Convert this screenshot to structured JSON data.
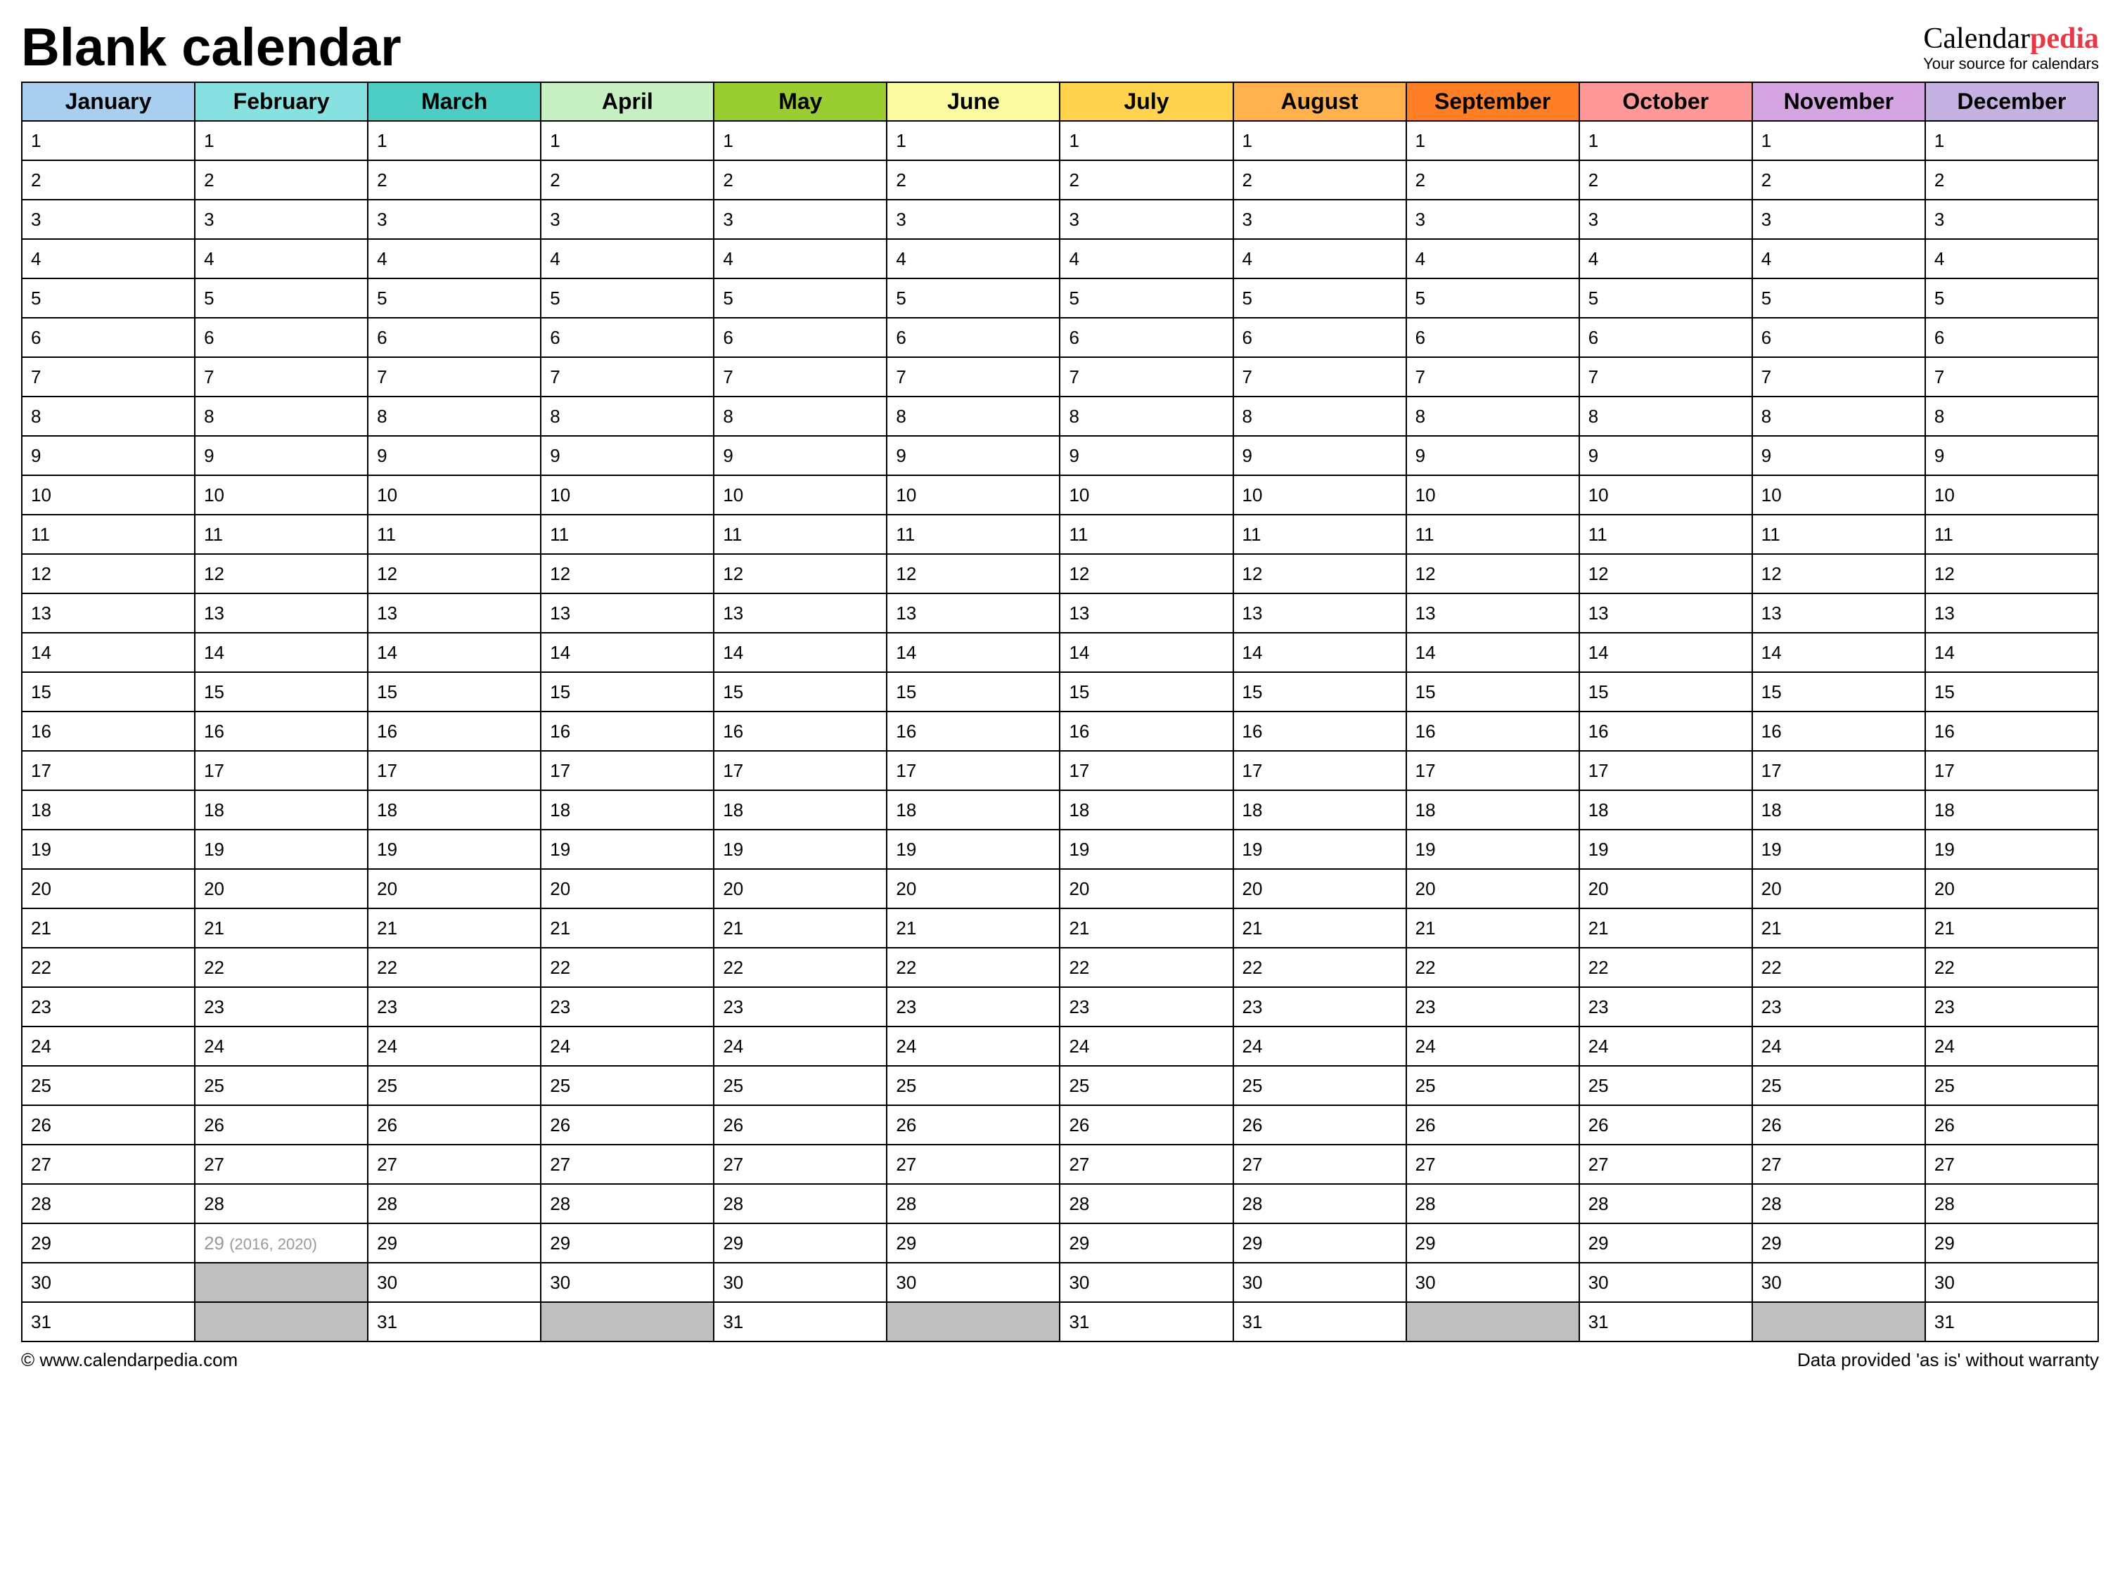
{
  "title": "Blank calendar",
  "brand": {
    "part1": "Calendar",
    "part2": "pedia",
    "tagline": "Your source for calendars"
  },
  "months": [
    {
      "name": "January",
      "color": "#a9cff0",
      "days": 31
    },
    {
      "name": "February",
      "color": "#88e1e1",
      "days": 29,
      "leap_day": 29,
      "leap_years": "(2016, 2020)"
    },
    {
      "name": "March",
      "color": "#4ecdc4",
      "days": 31
    },
    {
      "name": "April",
      "color": "#c6f0c2",
      "days": 30
    },
    {
      "name": "May",
      "color": "#9acd32",
      "days": 31
    },
    {
      "name": "June",
      "color": "#fafb9e",
      "days": 30
    },
    {
      "name": "July",
      "color": "#ffd34e",
      "days": 31
    },
    {
      "name": "August",
      "color": "#ffb14e",
      "days": 31
    },
    {
      "name": "September",
      "color": "#ff7f27",
      "days": 30
    },
    {
      "name": "October",
      "color": "#ff9999",
      "days": 31
    },
    {
      "name": "November",
      "color": "#d4a4e3",
      "days": 30
    },
    {
      "name": "December",
      "color": "#c3b1e1",
      "days": 31
    }
  ],
  "max_rows": 31,
  "footer": {
    "copyright": "© www.calendarpedia.com",
    "disclaimer": "Data provided 'as is' without warranty"
  }
}
